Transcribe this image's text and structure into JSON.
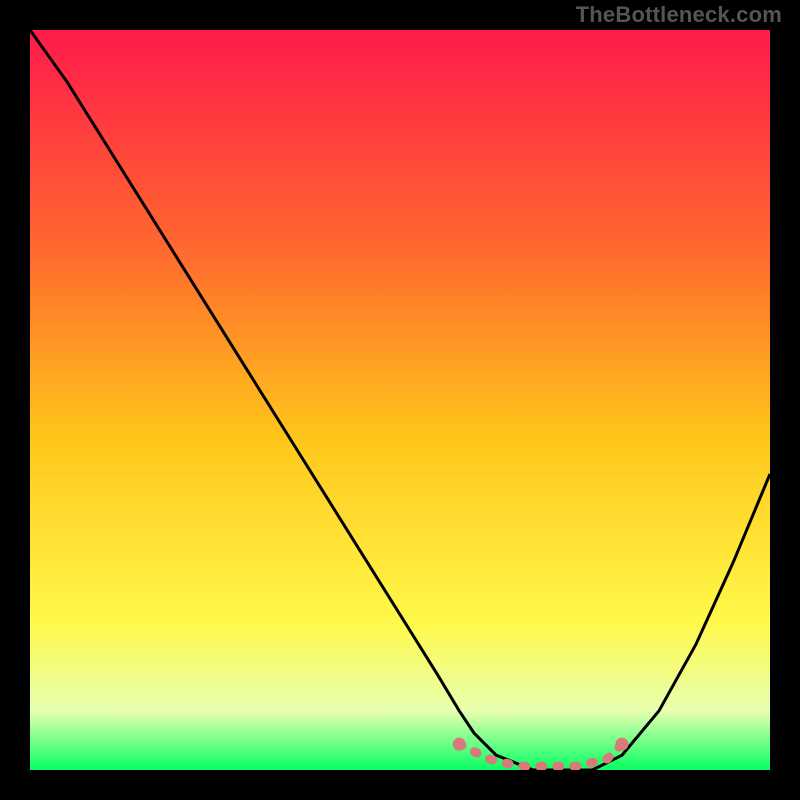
{
  "branding": {
    "text": "TheBottleneck.com"
  },
  "chart_data": {
    "type": "line",
    "title": "",
    "xlabel": "",
    "ylabel": "",
    "xlim": [
      0,
      100
    ],
    "ylim": [
      0,
      100
    ],
    "grid": false,
    "legend": false,
    "background_gradient": {
      "stops": [
        {
          "offset": 0.0,
          "color": "#ff1a4b"
        },
        {
          "offset": 0.3,
          "color": "#ff6a2e"
        },
        {
          "offset": 0.55,
          "color": "#ffc61a"
        },
        {
          "offset": 0.8,
          "color": "#fff94a"
        },
        {
          "offset": 0.92,
          "color": "#e8ffb0"
        },
        {
          "offset": 1.0,
          "color": "#08ff63"
        }
      ]
    },
    "series": [
      {
        "name": "bottleneck-curve",
        "color": "#000000",
        "x": [
          0,
          5,
          10,
          15,
          20,
          25,
          30,
          35,
          40,
          45,
          50,
          55,
          58,
          60,
          63,
          68,
          72,
          76,
          80,
          85,
          90,
          95,
          100
        ],
        "y": [
          100,
          93,
          85,
          77,
          69,
          61,
          53,
          45,
          37,
          29,
          21,
          13,
          8,
          5,
          2,
          0,
          0,
          0,
          2,
          8,
          17,
          28,
          40
        ]
      },
      {
        "name": "optimal-band",
        "color": "#d77a7a",
        "style": "marker-band",
        "x": [
          58,
          62,
          66,
          70,
          74,
          78,
          80
        ],
        "y": [
          3.5,
          1.5,
          0.5,
          0.5,
          0.5,
          1.5,
          3.5
        ]
      }
    ],
    "annotations": []
  }
}
